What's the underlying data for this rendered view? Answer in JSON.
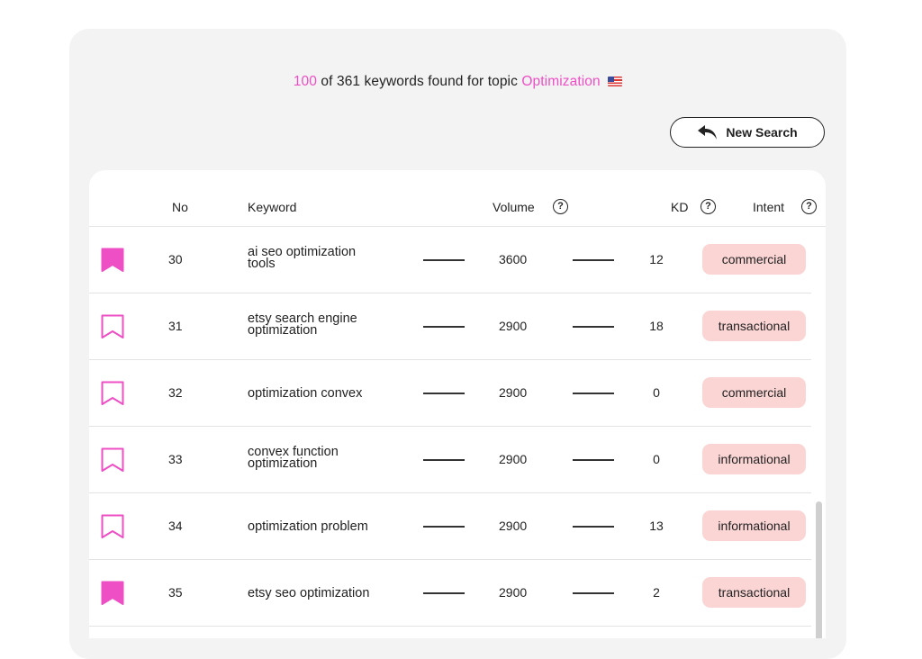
{
  "summary": {
    "shown": "100",
    "of": "of",
    "total_text": "361 keywords found for topic",
    "topic": "Optimization",
    "flag_icon": "us-flag-icon"
  },
  "new_search": {
    "label": "New Search",
    "icon": "undo-arrow-icon"
  },
  "table": {
    "headers": {
      "no": "No",
      "keyword": "Keyword",
      "volume": "Volume",
      "kd": "KD",
      "intent": "Intent",
      "help_icon": "?"
    },
    "rows": [
      {
        "no": "30",
        "kw1": "ai seo optimization",
        "kw2": "tools",
        "volume": "3600",
        "kd": "12",
        "intent": "commercial",
        "saved": true
      },
      {
        "no": "31",
        "kw1": "etsy search engine",
        "kw2": "optimization",
        "volume": "2900",
        "kd": "18",
        "intent": "transactional",
        "saved": false
      },
      {
        "no": "32",
        "kw1": "optimization convex",
        "kw2": "",
        "volume": "2900",
        "kd": "0",
        "intent": "commercial",
        "saved": false
      },
      {
        "no": "33",
        "kw1": "convex function",
        "kw2": "optimization",
        "volume": "2900",
        "kd": "0",
        "intent": "informational",
        "saved": false
      },
      {
        "no": "34",
        "kw1": "optimization problem",
        "kw2": "",
        "volume": "2900",
        "kd": "13",
        "intent": "informational",
        "saved": false
      },
      {
        "no": "35",
        "kw1": "etsy seo optimization",
        "kw2": "",
        "volume": "2900",
        "kd": "2",
        "intent": "transactional",
        "saved": true
      }
    ]
  },
  "colors": {
    "accent": "#ee4fc4",
    "intent_bg": "#fbd4d4",
    "panel_bg": "#f3f3f3"
  }
}
